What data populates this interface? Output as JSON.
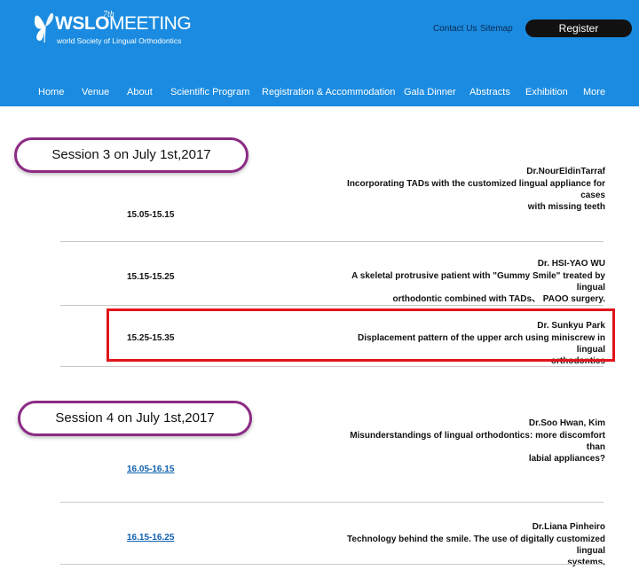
{
  "header": {
    "logo": {
      "main_bold": "WSLO",
      "main_light": "MEETING",
      "sup": "7th",
      "subtitle": "world Society of Lingual Orthodontics"
    },
    "top_links": [
      "Contact Us",
      "Sitemap"
    ],
    "register_label": "Register",
    "bg_color": "#1a8be0"
  },
  "nav": {
    "items": [
      "Home",
      "Venue",
      "About",
      "Scientific Program",
      "Registration & Accommodation",
      "Gala Dinner",
      "Abstracts",
      "Exhibition",
      "More"
    ]
  },
  "sessions": [
    {
      "title": "Session 3 on July 1st,2017",
      "talks": [
        {
          "time": "15.05-15.15",
          "speaker": "Dr.NourEldinTarraf",
          "topic_lines": [
            "Incorporating TADs with the customized lingual appliance for cases",
            "with missing teeth"
          ]
        },
        {
          "time": "15.15-15.25",
          "speaker": "Dr. HSI-YAO WU",
          "topic_lines": [
            "A skeletal protrusive patient with \"Gummy Smile\" treated by lingual",
            "orthodontic combined with TADs、 PAOO surgery."
          ]
        },
        {
          "time": "15.25-15.35",
          "speaker": "Dr. Sunkyu Park",
          "topic_lines": [
            "Displacement pattern of the upper arch using miniscrew in lingual",
            "orthodontics"
          ]
        }
      ]
    },
    {
      "title": "Session 4 on July 1st,2017",
      "talks": [
        {
          "time": "16.05-16.15",
          "speaker": "Dr.Soo Hwan, Kim",
          "topic_lines": [
            "Misunderstandings of lingual orthodontics: more discomfort than",
            "labial appliances?"
          ]
        },
        {
          "time": "16.15-16.25",
          "speaker": "Dr.Liana Pinheiro",
          "topic_lines": [
            "Technology behind the smile. The use of digitally customized lingual",
            "systems."
          ]
        }
      ]
    }
  ],
  "colors": {
    "banner_border": "#8c2a84",
    "highlight": "#e0141b",
    "link": "#1060b0"
  }
}
